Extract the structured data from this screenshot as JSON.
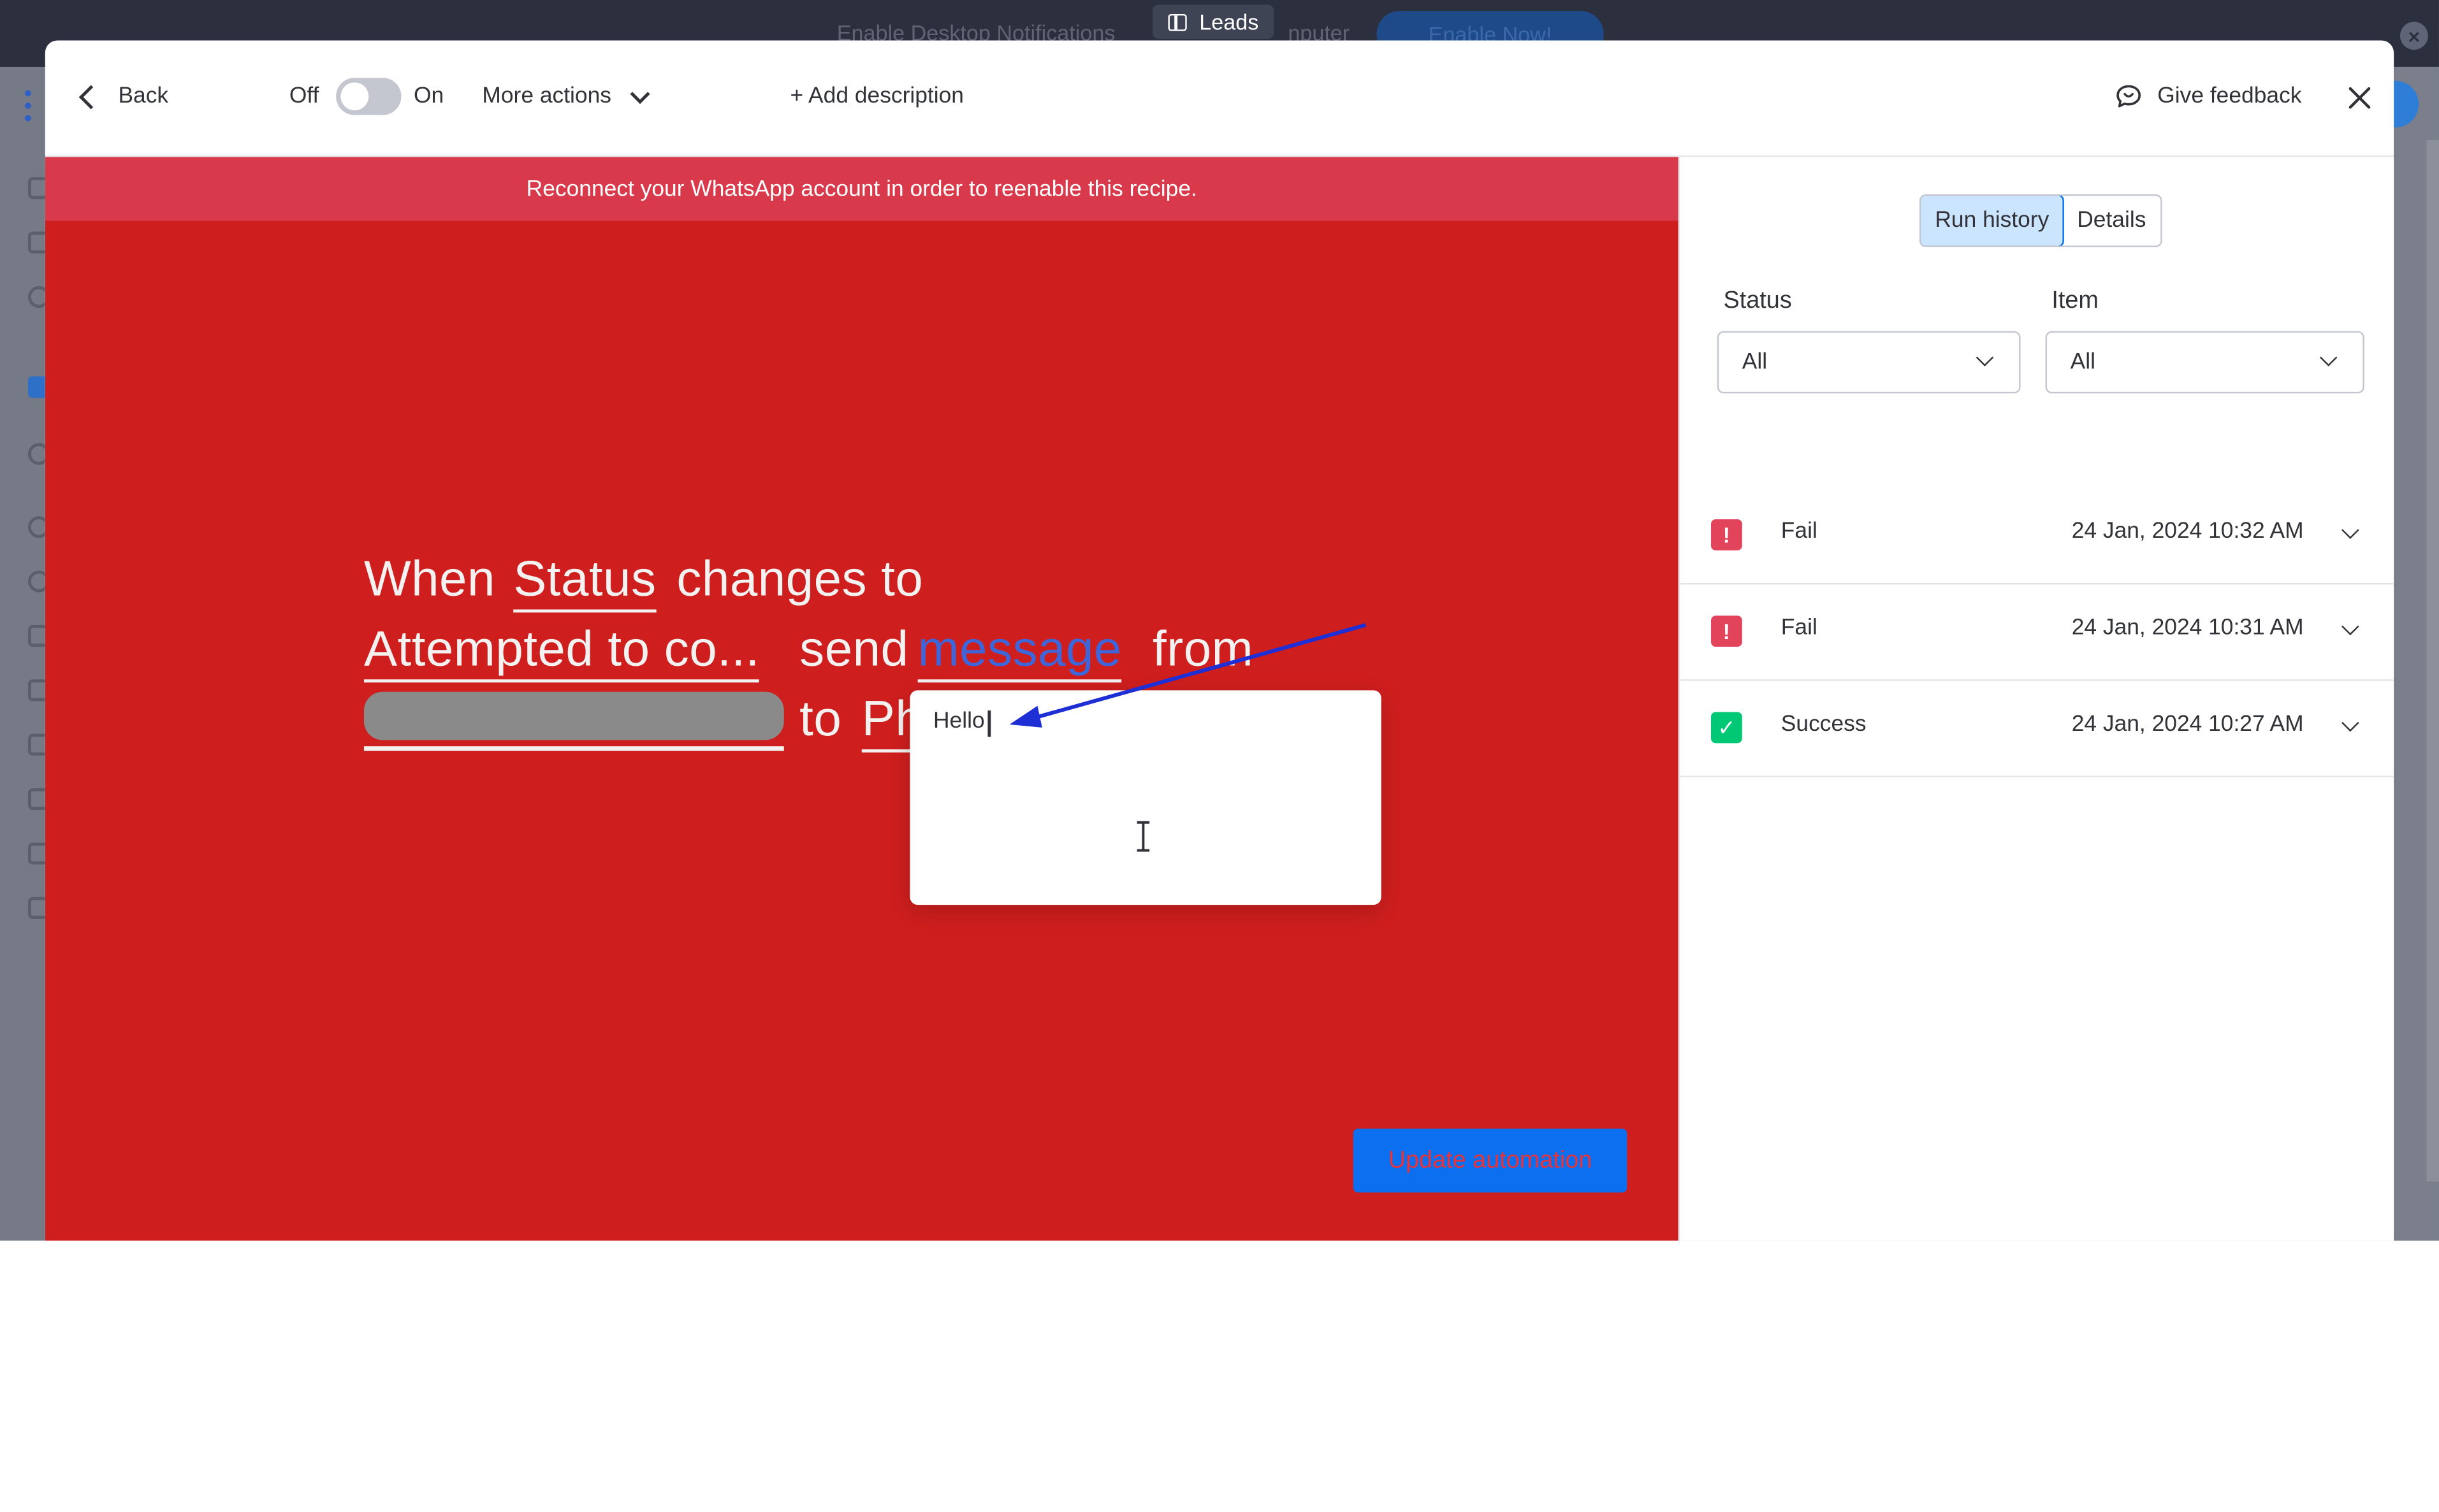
{
  "topbar": {
    "notification_text": "Enable Desktop Notifications",
    "notification_text_tail": "nputer",
    "enable_button": "Enable Now!",
    "board_name": "Leads"
  },
  "header": {
    "back_label": "Back",
    "toggle_off_label": "Off",
    "toggle_on_label": "On",
    "toggle_state": "off",
    "more_actions_label": "More actions",
    "add_description_label": "+ Add description",
    "feedback_label": "Give feedback"
  },
  "canvas": {
    "banner_text": "Reconnect your WhatsApp account in order to reenable this recipe.",
    "sentence": {
      "when": "When",
      "status": "Status",
      "changes_to": "changes to",
      "attempted": "Attempted to co...",
      "send": "send",
      "message": "message",
      "from": "from",
      "to": "to",
      "phone_partial": "Ph"
    },
    "message_popup": {
      "value": "Hello"
    },
    "update_button": "Update automation",
    "colors": {
      "canvas_bg": "#cf1e1e",
      "banner_bg": "#d93a4b",
      "annotation_arrow": "#1f2fd6",
      "primary_button": "#0b6ff0"
    }
  },
  "right_panel": {
    "tabs": [
      {
        "label": "Run history",
        "selected": true
      },
      {
        "label": "Details",
        "selected": false
      }
    ],
    "filters": {
      "status_label": "Status",
      "status_value": "All",
      "item_label": "Item",
      "item_value": "All"
    },
    "runs": [
      {
        "status": "Fail",
        "badge": "!",
        "time": "24 Jan, 2024 10:32 AM",
        "color": "#e2445c"
      },
      {
        "status": "Fail",
        "badge": "!",
        "time": "24 Jan, 2024 10:31 AM",
        "color": "#e2445c"
      },
      {
        "status": "Success",
        "badge": "✓",
        "time": "24 Jan, 2024 10:27 AM",
        "color": "#00c875"
      }
    ]
  }
}
